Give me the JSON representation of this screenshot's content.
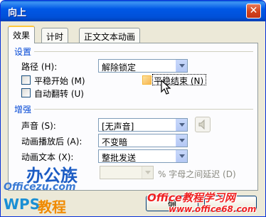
{
  "window": {
    "title": "向上",
    "close_glyph": "✕"
  },
  "tabs": [
    "效果",
    "计时",
    "正文文本动画"
  ],
  "settings": {
    "section_title": "设置",
    "path_label": "路径 (H):",
    "path_value": "解除锁定",
    "smooth_start_label": "平稳开始 (M)",
    "smooth_end_label": "平稳结束 (N)",
    "auto_reverse_label": "自动翻转 (U)"
  },
  "enhancements": {
    "section_title": "增强",
    "sound_label": "声音 (S):",
    "sound_value": "[无声音]",
    "after_animation_label": "动画播放后 (A):",
    "after_animation_value": "不变暗",
    "animate_text_label": "动画文本 (X):",
    "animate_text_value": "整批发送",
    "letter_delay_suffix": "% 字母之间延迟 (D)",
    "sound_icon": "speaker-icon"
  },
  "buttons": {
    "ok_partial": "确"
  },
  "watermarks": {
    "logo1": "办公族",
    "site1": "Officezu.com",
    "logo2_latin": "WPS",
    "logo2_cjk": "教程",
    "site2_line1": "Office教程学习网",
    "site2_line2": "www.office68.com"
  },
  "colors": {
    "title_blue": "#0058e6",
    "section_blue": "#0046d5",
    "close_red": "#d3421b",
    "watermark_orange": "#f08a00",
    "watermark_red": "#e22222"
  }
}
